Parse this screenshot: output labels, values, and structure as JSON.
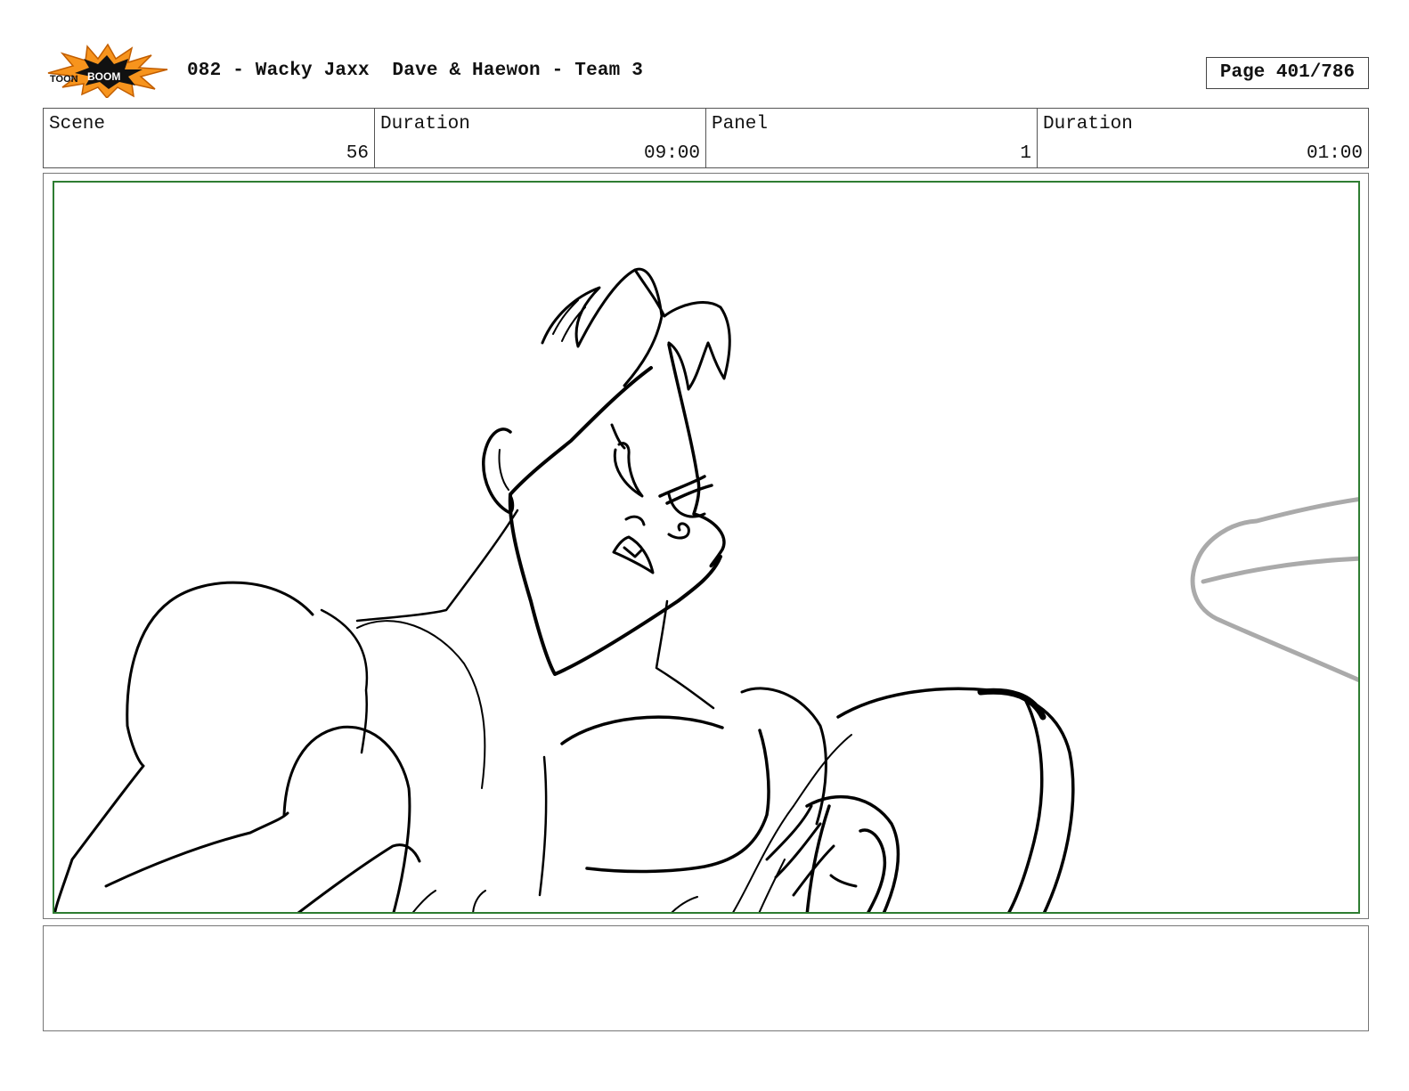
{
  "header": {
    "logo_text": "TOON BOOM",
    "title": "082 - Wacky Jaxx  Dave & Haewon - Team 3",
    "page_label": "Page 401/786"
  },
  "info": {
    "scene_label": "Scene",
    "scene_value": "56",
    "duration_label": "Duration",
    "duration_value": "09:00",
    "panel_label": "Panel",
    "panel_value": "1",
    "panel_duration_label": "Duration",
    "panel_duration_value": "01:00"
  },
  "colors": {
    "frame_border": "#2e7d32",
    "sketch_stroke": "#000000",
    "sketch_secondary": "#aaaaaa",
    "logo_burst": "#f7941d"
  },
  "notes": {
    "text": ""
  }
}
